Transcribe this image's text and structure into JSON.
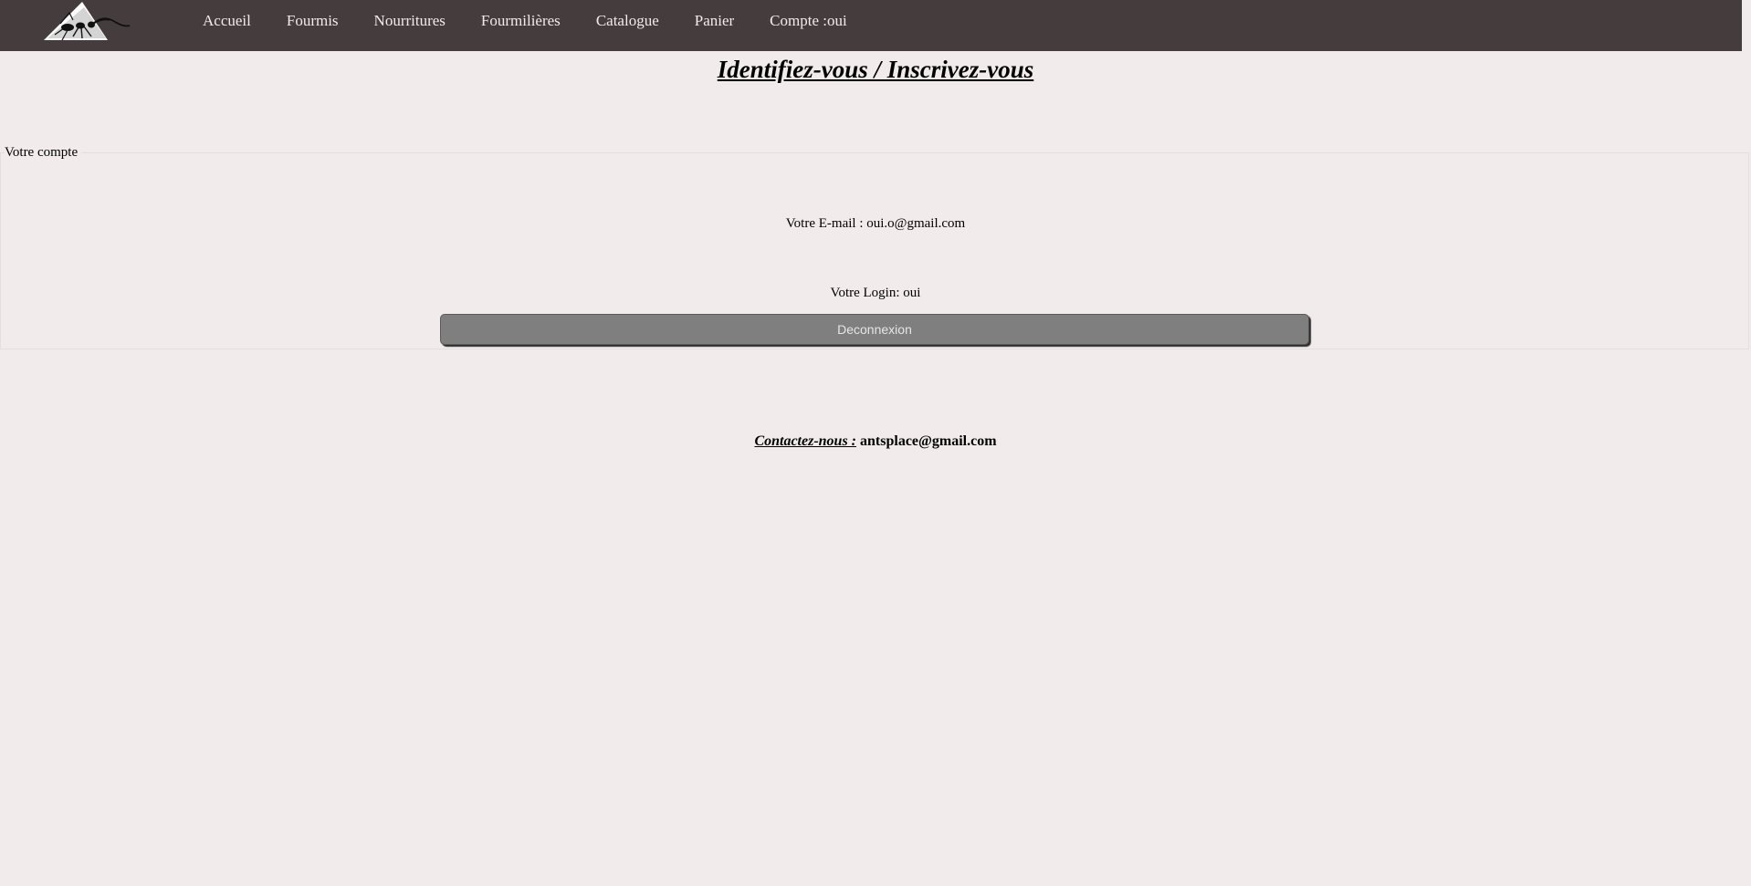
{
  "logo": {
    "icon": "ant-on-anthill-logo"
  },
  "nav": {
    "items": [
      {
        "label": "Accueil"
      },
      {
        "label": "Fourmis"
      },
      {
        "label": "Nourritures"
      },
      {
        "label": "Fourmilières"
      },
      {
        "label": "Catalogue"
      },
      {
        "label": "Panier"
      },
      {
        "label": "Compte :oui"
      }
    ]
  },
  "page": {
    "title": "Identifiez-vous / Inscrivez-vous"
  },
  "account": {
    "legend": "Votre compte",
    "email_text": "Votre E-mail : oui.o@gmail.com",
    "login_text": "Votre Login: oui",
    "logout_label": "Deconnexion"
  },
  "contact": {
    "label": "Contactez-nous :",
    "email": "antsplace@gmail.com"
  },
  "colors": {
    "navbar": "#453d3d",
    "background": "#f1ebeb",
    "button": "#7f7f7f"
  }
}
